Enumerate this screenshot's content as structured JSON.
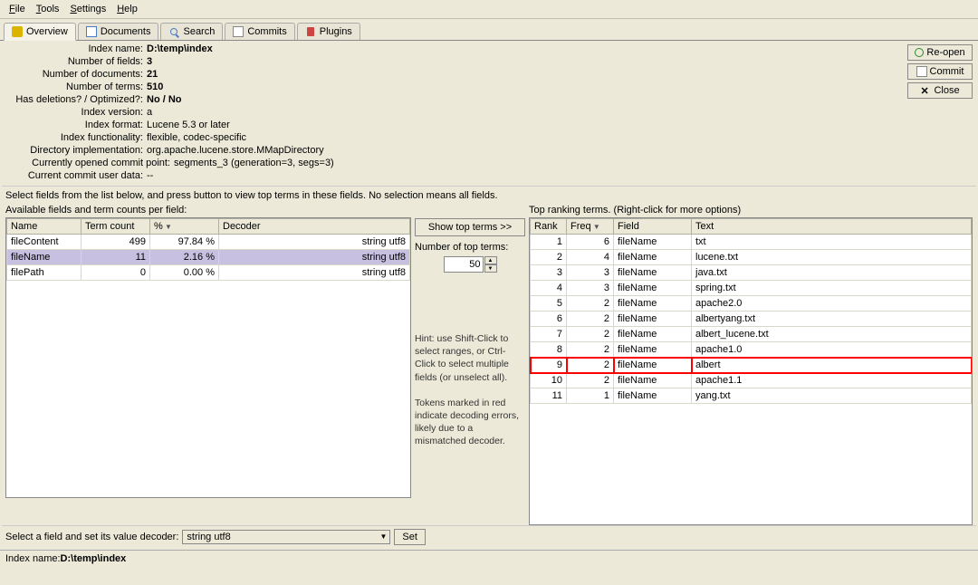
{
  "menu": {
    "file": "File",
    "tools": "Tools",
    "settings": "Settings",
    "help": "Help"
  },
  "tabs": [
    {
      "label": "Overview"
    },
    {
      "label": "Documents"
    },
    {
      "label": "Search"
    },
    {
      "label": "Commits"
    },
    {
      "label": "Plugins"
    }
  ],
  "summary": {
    "index_name_label": "Index name:",
    "index_name": "D:\\temp\\index",
    "num_fields_label": "Number of fields:",
    "num_fields": "3",
    "num_docs_label": "Number of documents:",
    "num_docs": "21",
    "num_terms_label": "Number of terms:",
    "num_terms": "510",
    "deletions_label": "Has deletions? / Optimized?:",
    "deletions": "No / No",
    "version_label": "Index version:",
    "version": "a",
    "format_label": "Index format:",
    "format": "Lucene 5.3 or later",
    "functionality_label": "Index functionality:",
    "functionality": "flexible, codec-specific",
    "dir_impl_label": "Directory implementation:",
    "dir_impl": "org.apache.lucene.store.MMapDirectory",
    "commit_point_label": "Currently opened commit point:",
    "commit_point": "segments_3 (generation=3, segs=3)",
    "user_data_label": "Current commit user data:",
    "user_data": "--"
  },
  "buttons": {
    "reopen": "Re-open",
    "commit": "Commit",
    "close": "Close"
  },
  "instruction": "Select fields from the list below, and press button to view top terms in these fields. No selection means all fields.",
  "left": {
    "title": "Available fields and term counts per field:",
    "headers": {
      "name": "Name",
      "term_count": "Term count",
      "percent": "%",
      "decoder": "Decoder"
    },
    "rows": [
      {
        "name": "fileContent",
        "count": "499",
        "pct": "97.84 %",
        "decoder": "string utf8"
      },
      {
        "name": "fileName",
        "count": "11",
        "pct": "2.16 %",
        "decoder": "string utf8"
      },
      {
        "name": "filePath",
        "count": "0",
        "pct": "0.00 %",
        "decoder": "string utf8"
      }
    ]
  },
  "middle": {
    "show_btn": "Show top terms >>",
    "num_terms_label": "Number of top terms:",
    "num_terms_value": "50",
    "hint1": "Hint: use Shift-Click to select ranges, or Ctrl-Click to select multiple fields (or unselect all).",
    "hint2": "Tokens marked in red indicate decoding errors, likely due to a mismatched decoder."
  },
  "right": {
    "title": "Top ranking terms. (Right-click for more options)",
    "headers": {
      "rank": "Rank",
      "freq": "Freq",
      "field": "Field",
      "text": "Text"
    },
    "rows": [
      {
        "rank": "1",
        "freq": "6",
        "field": "fileName",
        "text": "txt"
      },
      {
        "rank": "2",
        "freq": "4",
        "field": "fileName",
        "text": "lucene.txt"
      },
      {
        "rank": "3",
        "freq": "3",
        "field": "fileName",
        "text": "java.txt"
      },
      {
        "rank": "4",
        "freq": "3",
        "field": "fileName",
        "text": "spring.txt"
      },
      {
        "rank": "5",
        "freq": "2",
        "field": "fileName",
        "text": "apache2.0"
      },
      {
        "rank": "6",
        "freq": "2",
        "field": "fileName",
        "text": "albertyang.txt"
      },
      {
        "rank": "7",
        "freq": "2",
        "field": "fileName",
        "text": "albert_lucene.txt"
      },
      {
        "rank": "8",
        "freq": "2",
        "field": "fileName",
        "text": "apache1.0"
      },
      {
        "rank": "9",
        "freq": "2",
        "field": "fileName",
        "text": "albert"
      },
      {
        "rank": "10",
        "freq": "2",
        "field": "fileName",
        "text": "apache1.1"
      },
      {
        "rank": "11",
        "freq": "1",
        "field": "fileName",
        "text": "yang.txt"
      }
    ]
  },
  "decoder_row": {
    "label": "Select a field and set its value decoder:",
    "value": "string utf8",
    "set": "Set"
  },
  "status": {
    "label": "Index name: ",
    "value": "D:\\temp\\index"
  }
}
